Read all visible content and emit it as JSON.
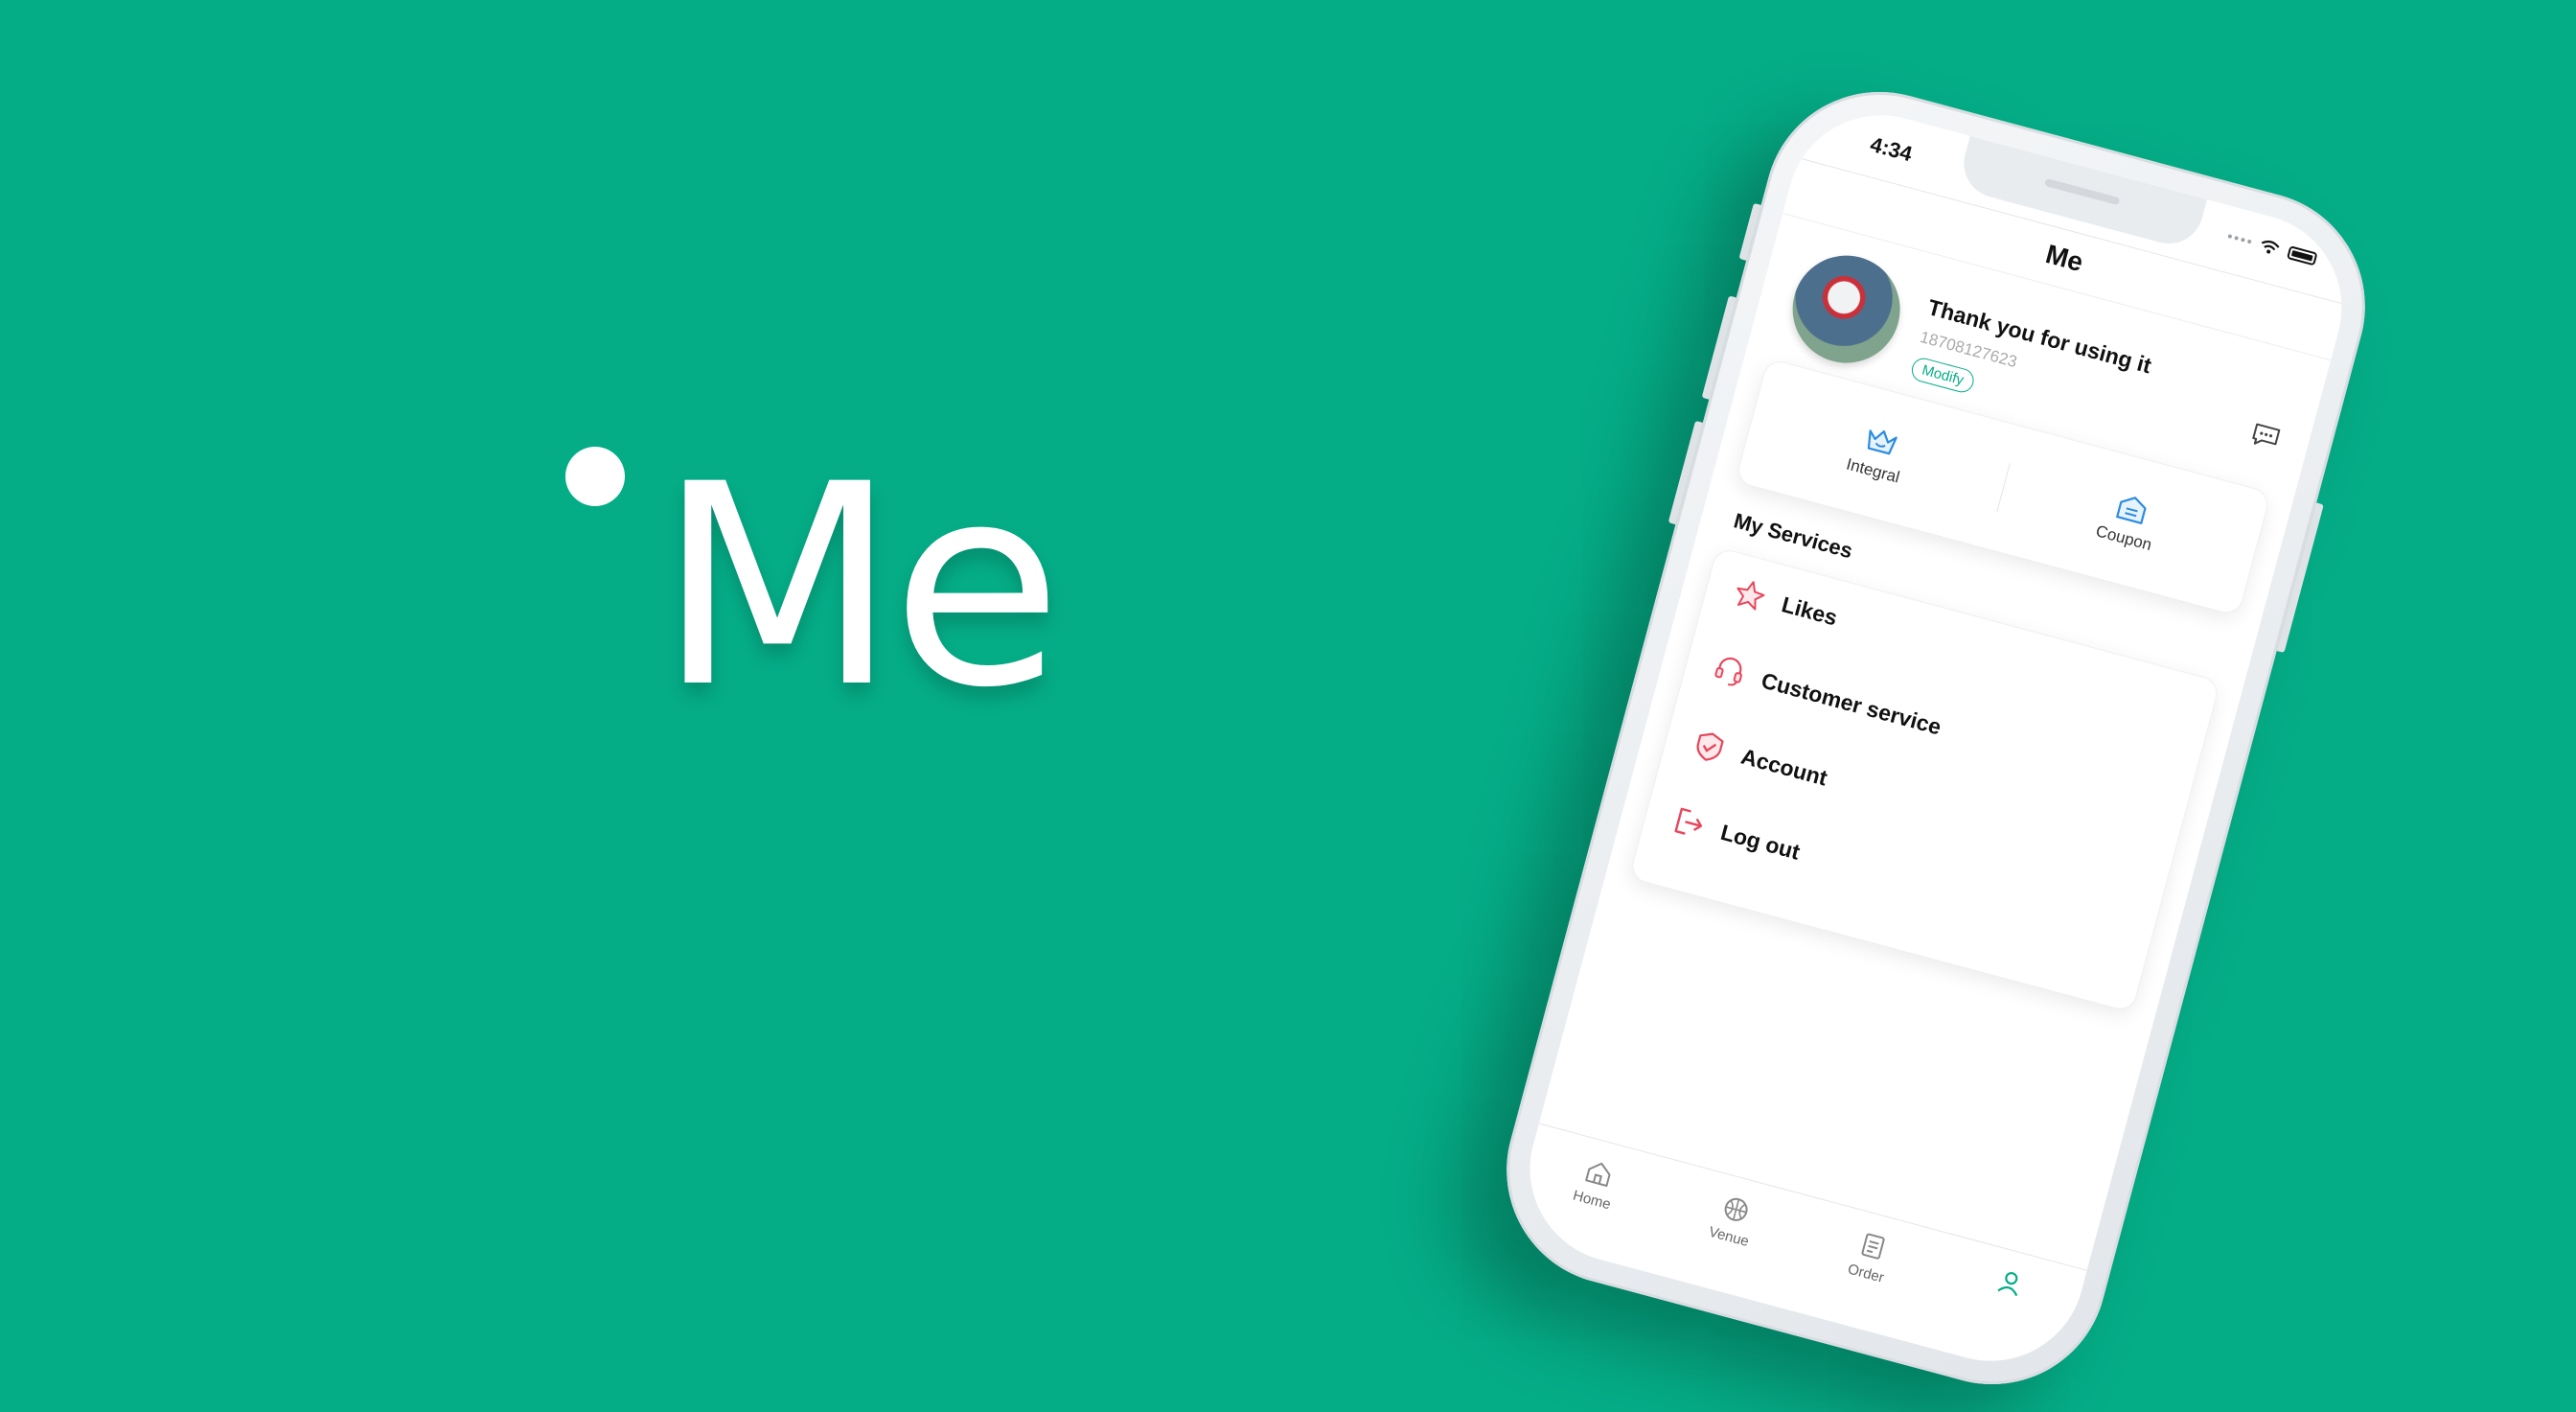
{
  "hero": {
    "title": "Me"
  },
  "status_bar": {
    "time": "4:34"
  },
  "header": {
    "title": "Me"
  },
  "profile": {
    "name": "Thank you for using it",
    "phone": "18708127623",
    "modify_label": "Modify"
  },
  "points": [
    {
      "label": "Integral",
      "icon": "crown-icon"
    },
    {
      "label": "Coupon",
      "icon": "coupon-icon"
    }
  ],
  "services": {
    "title": "My Services",
    "items": [
      {
        "label": "Likes",
        "icon": "star-icon"
      },
      {
        "label": "Customer service",
        "icon": "headset-icon"
      },
      {
        "label": "Account",
        "icon": "shield-icon"
      },
      {
        "label": "Log out",
        "icon": "logout-icon"
      }
    ]
  },
  "tabbar": [
    {
      "label": "Home",
      "icon": "home-icon"
    },
    {
      "label": "Venue",
      "icon": "basketball-icon"
    },
    {
      "label": "Order",
      "icon": "order-icon"
    },
    {
      "label": "",
      "icon": "user-icon"
    }
  ],
  "colors": {
    "brand": "#05ad87",
    "accent_red": "#e8465a",
    "accent_blue": "#2a8ce0"
  }
}
